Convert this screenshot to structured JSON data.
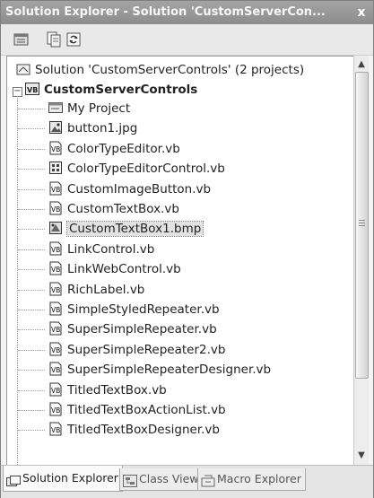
{
  "window": {
    "title": "Solution Explorer - Solution 'CustomServerCon...",
    "close_glyph": "x"
  },
  "toolbar": {
    "buttons": [
      {
        "name": "properties-button-icon"
      },
      {
        "name": "show-all-files-button-icon"
      },
      {
        "name": "refresh-button-icon"
      }
    ]
  },
  "tree": {
    "solution_label": "Solution 'CustomServerControls' (2 projects)",
    "project_label": "CustomServerControls",
    "project_expander": "−",
    "items": [
      {
        "label": "My Project",
        "icon": "my-project-icon"
      },
      {
        "label": "button1.jpg",
        "icon": "image-file-icon"
      },
      {
        "label": "ColorTypeEditor.vb",
        "icon": "vb-file-icon"
      },
      {
        "label": "ColorTypeEditorControl.vb",
        "icon": "user-control-icon"
      },
      {
        "label": "CustomImageButton.vb",
        "icon": "vb-file-icon"
      },
      {
        "label": "CustomTextBox.vb",
        "icon": "vb-file-icon"
      },
      {
        "label": "CustomTextBox1.bmp",
        "icon": "bitmap-file-icon"
      },
      {
        "label": "LinkControl.vb",
        "icon": "vb-file-icon"
      },
      {
        "label": "LinkWebControl.vb",
        "icon": "vb-file-icon"
      },
      {
        "label": "RichLabel.vb",
        "icon": "vb-file-icon"
      },
      {
        "label": "SimpleStyledRepeater.vb",
        "icon": "vb-file-icon"
      },
      {
        "label": "SuperSimpleRepeater.vb",
        "icon": "vb-file-icon"
      },
      {
        "label": "SuperSimpleRepeater2.vb",
        "icon": "vb-file-icon"
      },
      {
        "label": "SuperSimpleRepeaterDesigner.vb",
        "icon": "vb-file-icon"
      },
      {
        "label": "TitledTextBox.vb",
        "icon": "vb-file-icon"
      },
      {
        "label": "TitledTextBoxActionList.vb",
        "icon": "vb-file-icon"
      },
      {
        "label": "TitledTextBoxDesigner.vb",
        "icon": "vb-file-icon"
      }
    ],
    "selected_item": "CustomTextBox1.bmp"
  },
  "tabs": [
    {
      "label": "Solution Explorer",
      "active": true
    },
    {
      "label": "Class View",
      "active": false
    },
    {
      "label": "Macro Explorer",
      "active": false
    }
  ],
  "icon_text": {
    "vb": "VB"
  }
}
